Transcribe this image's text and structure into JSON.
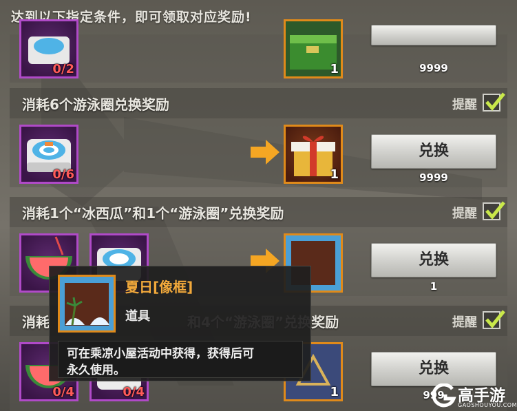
{
  "header": {
    "text": "达到以下指定条件，即可领取对应奖励!"
  },
  "rows": [
    {
      "title": "",
      "inputs": [
        {
          "icon": "swim-ring-icon",
          "count": "0/2"
        }
      ],
      "reward": {
        "icon": "green-supply-box-icon",
        "count": "1"
      },
      "button": "",
      "limit": "9999"
    },
    {
      "title": "消耗6个游泳圈兑换奖励",
      "remind": "提醒",
      "inputs": [
        {
          "icon": "swim-ring-icon",
          "count": "0/6"
        }
      ],
      "reward": {
        "icon": "gift-box-icon",
        "count": "1"
      },
      "button": "兑换",
      "limit": "9999"
    },
    {
      "title": "消耗1个“冰西瓜”和1个“游泳圈”兑换奖励",
      "remind": "提醒",
      "inputs": [
        {
          "icon": "watermelon-icon",
          "count": ""
        },
        {
          "icon": "swim-ring-icon",
          "count": ""
        }
      ],
      "reward": {
        "icon": "summer-frame-icon",
        "count": ""
      },
      "button": "兑换",
      "limit": "1"
    },
    {
      "title_left": "消耗",
      "title_right": "和4个“游泳圈”兑换奖励",
      "remind": "提醒",
      "inputs": [
        {
          "icon": "watermelon-icon",
          "count": "0/4"
        },
        {
          "icon": "swim-ring-icon",
          "count": "0/4"
        }
      ],
      "reward": {
        "icon": "emblem-crate-icon",
        "count": "1"
      },
      "button": "兑换",
      "limit": "999"
    }
  ],
  "tooltip": {
    "name": "夏日[像框]",
    "type": "道具",
    "desc_line1": "可在乘凉小屋活动中获得，获得后可",
    "desc_line2": "永久使用。"
  },
  "watermark": {
    "brand": "高手游",
    "url": "GAOSHOUYOU.COM"
  },
  "colors": {
    "purple_frame": "#b04ac8",
    "gold_frame": "#e08a1a",
    "check_green": "#c9e84a",
    "count_red": "#ff5a5a",
    "tooltip_name": "#f2a93b"
  }
}
